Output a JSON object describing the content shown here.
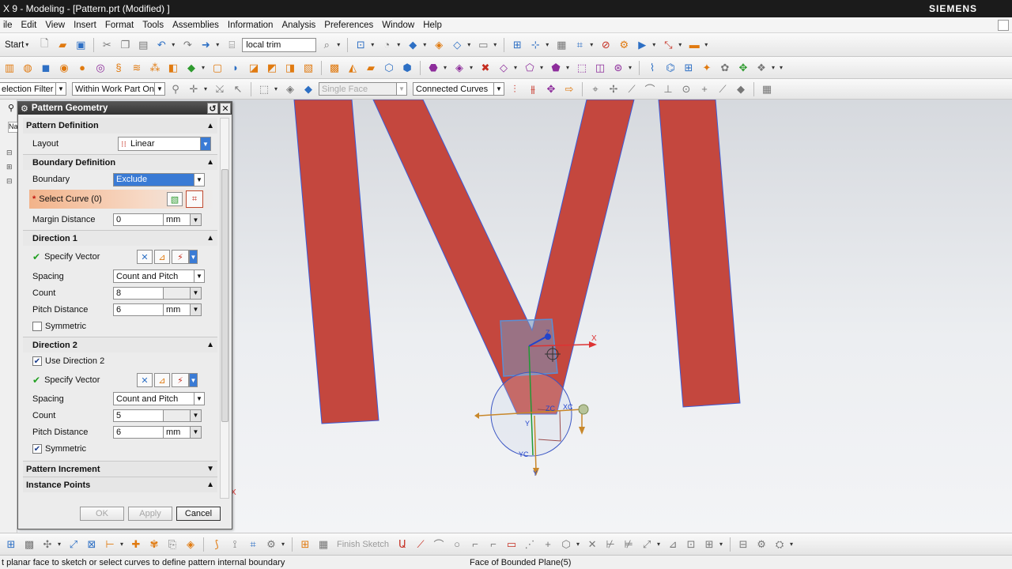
{
  "window": {
    "title": "X 9 - Modeling - [Pattern.prt (Modified) ]",
    "brand": "SIEMENS"
  },
  "menu": [
    "ile",
    "Edit",
    "View",
    "Insert",
    "Format",
    "Tools",
    "Assemblies",
    "Information",
    "Analysis",
    "Preferences",
    "Window",
    "Help"
  ],
  "toolbar": {
    "start_label": "Start",
    "search_value": "local trim"
  },
  "selection_bar": {
    "filter": "election Filter",
    "scope": "Within Work Part Only",
    "face_rule": "Single Face",
    "curve_rule": "Connected Curves"
  },
  "resource_bar": {
    "tab_label": "Na"
  },
  "dialog": {
    "title": "Pattern Geometry",
    "pattern_definition": "Pattern Definition",
    "layout_label": "Layout",
    "layout_value": "Linear",
    "boundary_definition": "Boundary Definition",
    "boundary_label": "Boundary",
    "boundary_value": "Exclude",
    "select_curve": "Select Curve (0)",
    "margin_label": "Margin Distance",
    "margin_value": "0",
    "margin_unit": "mm",
    "direction1": {
      "header": "Direction 1",
      "specify_vector": "Specify Vector",
      "spacing_label": "Spacing",
      "spacing_value": "Count and Pitch",
      "count_label": "Count",
      "count_value": "8",
      "pitch_label": "Pitch Distance",
      "pitch_value": "6",
      "pitch_unit": "mm",
      "symmetric_label": "Symmetric",
      "symmetric_checked": false
    },
    "direction2": {
      "header": "Direction 2",
      "use_label": "Use Direction 2",
      "use_checked": true,
      "specify_vector": "Specify Vector",
      "spacing_label": "Spacing",
      "spacing_value": "Count and Pitch",
      "count_label": "Count",
      "count_value": "5",
      "pitch_label": "Pitch Distance",
      "pitch_value": "6",
      "pitch_unit": "mm",
      "symmetric_label": "Symmetric",
      "symmetric_checked": true
    },
    "pattern_increment": "Pattern Increment",
    "instance_points": "Instance Points",
    "ok": "OK",
    "apply": "Apply",
    "cancel": "Cancel"
  },
  "bottom_toolbar": {
    "finish_sketch": "Finish Sketch"
  },
  "statusbar": {
    "prompt": "t planar face to sketch or select curves to define pattern internal boundary",
    "status": "Face of Bounded Plane(5)"
  },
  "scene": {
    "axis_x": "X",
    "axis_y": "Y",
    "axis_z": "Z",
    "axis_xc": "XC",
    "axis_yc": "YC",
    "axis_zc": "ZC",
    "shape_color": "#c4473e",
    "edge_color": "#3c5bd6"
  },
  "colors": {
    "accent_highlight": "#3a7bd5",
    "required_field": "#f2b38a"
  }
}
